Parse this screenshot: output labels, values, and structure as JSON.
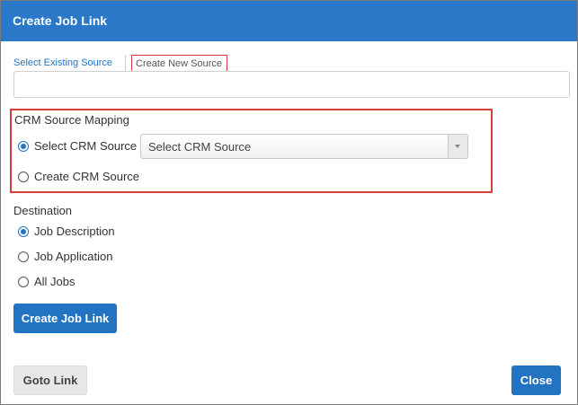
{
  "dialog": {
    "title": "Create Job Link"
  },
  "source_tabs": {
    "existing_label": "Select Existing Source",
    "new_label": "Create New Source",
    "active": "Create New Source"
  },
  "source_name_input": {
    "value": "",
    "placeholder": ""
  },
  "crm_mapping": {
    "label": "CRM Source Mapping",
    "select_option": {
      "label": "Select CRM Source",
      "checked": true
    },
    "create_option": {
      "label": "Create CRM Source",
      "checked": false
    },
    "dropdown": {
      "selected": "Select CRM Source"
    }
  },
  "destination": {
    "label": "Destination",
    "options": [
      {
        "label": "Job Description",
        "checked": true
      },
      {
        "label": "Job Application",
        "checked": false
      },
      {
        "label": "All Jobs",
        "checked": false
      }
    ]
  },
  "buttons": {
    "create_job_link": "Create Job Link",
    "goto_link": "Goto Link",
    "close": "Close"
  },
  "colors": {
    "header": "#2b78c9",
    "primary_button": "#2273c2",
    "highlight_border": "#d83c3c",
    "secondary_button": "#e7e7e7"
  }
}
